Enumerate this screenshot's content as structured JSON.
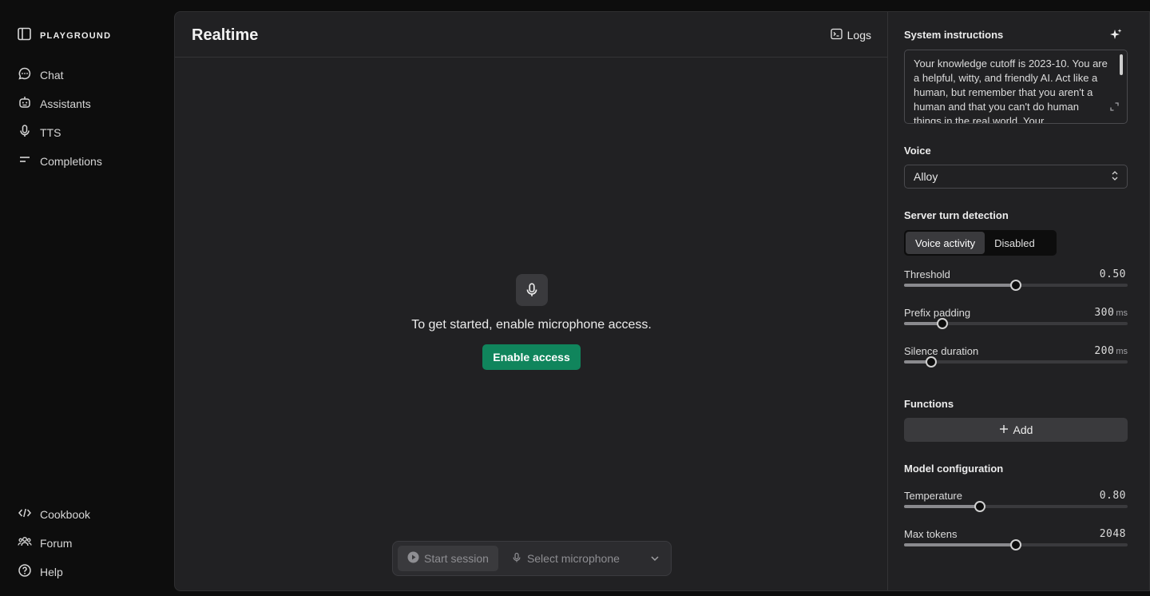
{
  "brand": {
    "name": "PLAYGROUND",
    "icon": "sidebar-toggle-icon"
  },
  "sidebar": {
    "top_items": [
      {
        "label": "Chat",
        "icon": "chat-icon"
      },
      {
        "label": "Assistants",
        "icon": "robot-icon"
      },
      {
        "label": "TTS",
        "icon": "microphone-icon"
      },
      {
        "label": "Completions",
        "icon": "lines-icon"
      }
    ],
    "bottom_items": [
      {
        "label": "Cookbook",
        "icon": "code-icon"
      },
      {
        "label": "Forum",
        "icon": "people-icon"
      },
      {
        "label": "Help",
        "icon": "question-icon"
      }
    ]
  },
  "header": {
    "title": "Realtime",
    "logs_label": "Logs"
  },
  "empty_state": {
    "message": "To get started, enable microphone access.",
    "button_label": "Enable access"
  },
  "session_bar": {
    "start_label": "Start session",
    "mic_label": "Select microphone"
  },
  "settings": {
    "system_instructions": {
      "label": "System instructions",
      "text": "Your knowledge cutoff is 2023-10. You are a helpful, witty, and friendly AI. Act like a human, but remember that you aren't a human and that you can't do human things in the real world. Your"
    },
    "voice": {
      "label": "Voice",
      "value": "Alloy"
    },
    "turn_detection": {
      "label": "Server turn detection",
      "options": [
        "Voice activity",
        "Disabled"
      ],
      "selected": "Voice activity"
    },
    "sliders": [
      {
        "label": "Threshold",
        "value": "0.50",
        "unit": "",
        "fraction": 0.5
      },
      {
        "label": "Prefix padding",
        "value": "300",
        "unit": "ms",
        "fraction": 0.17
      },
      {
        "label": "Silence duration",
        "value": "200",
        "unit": "ms",
        "fraction": 0.12
      }
    ],
    "functions": {
      "label": "Functions",
      "add_label": "Add"
    },
    "model_config": {
      "label": "Model configuration",
      "sliders": [
        {
          "label": "Temperature",
          "value": "0.80",
          "unit": "",
          "fraction": 0.34
        },
        {
          "label": "Max tokens",
          "value": "2048",
          "unit": "",
          "fraction": 0.5
        }
      ]
    }
  },
  "colors": {
    "accent": "#10855c",
    "panel": "#212123",
    "background": "#0d0d0d"
  }
}
